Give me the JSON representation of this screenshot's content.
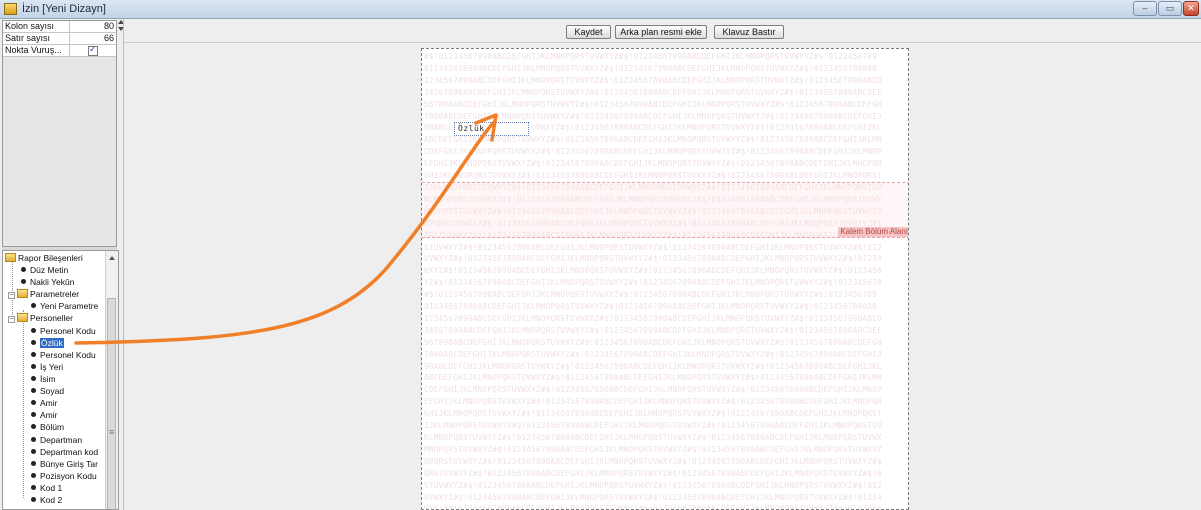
{
  "window": {
    "title": "İzin [Yeni Dizayn]"
  },
  "properties": [
    {
      "name": "Kolon sayısı",
      "value": "80"
    },
    {
      "name": "Satır sayısı",
      "value": "66"
    },
    {
      "name": "Nokta Vuruş...",
      "value": ""
    }
  ],
  "toolbar": {
    "save_label": "Kaydet",
    "add_background_label": "Arka plan resmi ekle",
    "print_guide_label": "Klavuz Bastır"
  },
  "tree": {
    "root": "Rapor Bileşenleri",
    "items": {
      "plain_text": "Düz Metin",
      "carried_total": "Nakli Yekûn",
      "parameters": "Parametreler",
      "new_parameter": "Yeni Parametre",
      "personnel": "Personeller",
      "personnel_code": "Personel Kodu",
      "selected": "Özlük",
      "personnel_code2": "Personel Kodu",
      "workplace": "İş Yeri",
      "first_name": "İsim",
      "surname": "Soyad",
      "manager1": "Amir",
      "manager2": "Amir",
      "section": "Bölüm",
      "department": "Departman",
      "department_code": "Departman kod",
      "entry_date": "Bünye Giriş Tar",
      "position_code": "Pozisyon Kodu",
      "code1": "Kod 1",
      "code2": "Kod 2"
    }
  },
  "canvas": {
    "placed_field_text": "Özlük",
    "band_label": "Kalem Bölüm Alanı",
    "background_pattern": [
      "#$!01234567890ABCDEFGHIJKLMNOPQRSTUVWXYZ#$!01234567890ABCDEFGHIJKLMNOPQRSTUVWXYZ#$!0123456789",
      "01234567890ABCDEFGHIJKLMNOPQRSTUVWXYZ#$!01234567890ABCDEFGHIJKLMNOPQRSTUVWXYZ#$!01234567890AB",
      "1234567890ABCDEFGHIJKLMNOPQRSTUVWXYZ#$!01234567890ABCDEFGHIJKLMNOPQRSTUVWXYZ#$!01234567890ABCD",
      "34567890ABCDEFGHIJKLMNOPQRSTUVWXYZ#$!01234567890ABCDEFGHIJKLMNOPQRSTUVWXYZ#$!01234567890ABCDEF",
      "567890ABCDEFGHIJKLMNOPQRSTUVWXYZ#$!01234567890ABCDEFGHIJKLMNOPQRSTUVWXYZ#$!01234567890ABCDEFGH",
      "7890ABCDEFGHIJKLMNOPQRSTUVWXYZ#$!01234567890ABCDEFGHIJKLMNOPQRSTUVWXYZ#$!01234567890ABCDEFGHIJ",
      "90ABCDEFGHIJKLMNOPQRSTUVWXYZ#$!01234567890ABCDEFGHIJKLMNOPQRSTUVWXYZ#$!01234567890ABCDEFGHIJKL",
      "ABCDEFGHIJKLMNOPQRSTUVWXYZ#$!01234567890ABCDEFGHIJKLMNOPQRSTUVWXYZ#$!01234567890ABCDEFGHIJKLMN",
      "CDEFGHIJKLMNOPQRSTUVWXYZ#$!01234567890ABCDEFGHIJKLMNOPQRSTUVWXYZ#$!01234567890ABCDEFGHIJKLMNOP",
      "EFGHIJKLMNOPQRSTUVWXYZ#$!01234567890ABCDEFGHIJKLMNOPQRSTUVWXYZ#$!01234567890ABCDEFGHIJKLMNOPQR",
      "GHIJKLMNOPQRSTUVWXYZ#$!01234567890ABCDEFGHIJKLMNOPQRSTUVWXYZ#$!01234567890ABCDEFGHIJKLMNOPQRST",
      "IJKLMNOPQRSTUVWXYZ#$!01234567890ABCDEFGHIJKLMNOPQRSTUVWXYZ#$!01234567890ABCDEFGHIJKLMNOPQRSTUV",
      "KLMNOPQRSTUVWXYZ#$!01234567890ABCDEFGHIJKLMNOPQRSTUVWXYZ#$!01234567890ABCDEFGHIJKLMNOPQRSTUVWX",
      "MNOPQRSTUVWXYZ#$!01234567890ABCDEFGHIJKLMNOPQRSTUVWXYZ#$!01234567890ABCDEFGHIJKLMNOPQRSTUVWXYZ",
      "OPQRSTUVWXYZ#$!01234567890ABCDEFGHIJKLMNOPQRSTUVWXYZ#$!01234567890ABCDEFGHIJKLMNOPQRSTUVWXYZ#$",
      "QRSTUVWXYZ#$!01234567890ABCDEFGHIJKLMNOPQRSTUVWXYZ#$!01234567890ABCDEFGHIJKLMNOPQRSTUVWXYZ#$!0",
      "STUVWXYZ#$!01234567890ABCDEFGHIJKLMNOPQRSTUVWXYZ#$!01234567890ABCDEFGHIJKLMNOPQRSTUVWXYZ#$!012",
      "UVWXYZ#$!01234567890ABCDEFGHIJKLMNOPQRSTUVWXYZ#$!01234567890ABCDEFGHIJKLMNOPQRSTUVWXYZ#$!01234",
      "WXYZ#$!01234567890ABCDEFGHIJKLMNOPQRSTUVWXYZ#$!01234567890ABCDEFGHIJKLMNOPQRSTUVWXYZ#$!0123456",
      "YZ#$!01234567890ABCDEFGHIJKLMNOPQRSTUVWXYZ#$!01234567890ABCDEFGHIJKLMNOPQRSTUVWXYZ#$!012345678",
      "#$!01234567890ABCDEFGHIJKLMNOPQRSTUVWXYZ#$!01234567890ABCDEFGHIJKLMNOPQRSTUVWXYZ#$!0123456789",
      "01234567890ABCDEFGHIJKLMNOPQRSTUVWXYZ#$!01234567890ABCDEFGHIJKLMNOPQRSTUVWXYZ#$!01234567890AB",
      "1234567890ABCDEFGHIJKLMNOPQRSTUVWXYZ#$!01234567890ABCDEFGHIJKLMNOPQRSTUVWXYZ#$!01234567890ABCD",
      "34567890ABCDEFGHIJKLMNOPQRSTUVWXYZ#$!01234567890ABCDEFGHIJKLMNOPQRSTUVWXYZ#$!01234567890ABCDEF",
      "567890ABCDEFGHIJKLMNOPQRSTUVWXYZ#$!01234567890ABCDEFGHIJKLMNOPQRSTUVWXYZ#$!01234567890ABCDEFGH",
      "7890ABCDEFGHIJKLMNOPQRSTUVWXYZ#$!01234567890ABCDEFGHIJKLMNOPQRSTUVWXYZ#$!01234567890ABCDEFGHIJ",
      "90ABCDEFGHIJKLMNOPQRSTUVWXYZ#$!01234567890ABCDEFGHIJKLMNOPQRSTUVWXYZ#$!01234567890ABCDEFGHIJKL",
      "ABCDEFGHIJKLMNOPQRSTUVWXYZ#$!01234567890ABCDEFGHIJKLMNOPQRSTUVWXYZ#$!01234567890ABCDEFGHIJKLMN",
      "CDEFGHIJKLMNOPQRSTUVWXYZ#$!01234567890ABCDEFGHIJKLMNOPQRSTUVWXYZ#$!01234567890ABCDEFGHIJKLMNOP",
      "EFGHIJKLMNOPQRSTUVWXYZ#$!01234567890ABCDEFGHIJKLMNOPQRSTUVWXYZ#$!01234567890ABCDEFGHIJKLMNOPQR",
      "GHIJKLMNOPQRSTUVWXYZ#$!01234567890ABCDEFGHIJKLMNOPQRSTUVWXYZ#$!01234567890ABCDEFGHIJKLMNOPQRST",
      "IJKLMNOPQRSTUVWXYZ#$!01234567890ABCDEFGHIJKLMNOPQRSTUVWXYZ#$!01234567890ABCDEFGHIJKLMNOPQRSTUV",
      "KLMNOPQRSTUVWXYZ#$!01234567890ABCDEFGHIJKLMNOPQRSTUVWXYZ#$!01234567890ABCDEFGHIJKLMNOPQRSTUVWX",
      "MNOPQRSTUVWXYZ#$!01234567890ABCDEFGHIJKLMNOPQRSTUVWXYZ#$!01234567890ABCDEFGHIJKLMNOPQRSTUVWXYZ",
      "OPQRSTUVWXYZ#$!01234567890ABCDEFGHIJKLMNOPQRSTUVWXYZ#$!01234567890ABCDEFGHIJKLMNOPQRSTUVWXYZ#$",
      "QRSTUVWXYZ#$!01234567890ABCDEFGHIJKLMNOPQRSTUVWXYZ#$!01234567890ABCDEFGHIJKLMNOPQRSTUVWXYZ#$!0",
      "STUVWXYZ#$!01234567890ABCDEFGHIJKLMNOPQRSTUVWXYZ#$!01234567890ABCDEFGHIJKLMNOPQRSTUVWXYZ#$!012",
      "UVWXYZ#$!01234567890ABCDEFGHIJKLMNOPQRSTUVWXYZ#$!01234567890ABCDEFGHIJKLMNOPQRSTUVWXYZ#$!01234",
      "WXYZ#$!01234567890ABCDEFGHIJKLMNOPQRSTUVWXYZ#$!01234567890ABCDEFGHIJKLMNOPQRSTUVWXYZ#$!0123456"
    ]
  },
  "colors": {
    "annotation_arrow": "#f07f28",
    "selection": "#316ac5",
    "band_label_bg": "#f6c3c3"
  }
}
